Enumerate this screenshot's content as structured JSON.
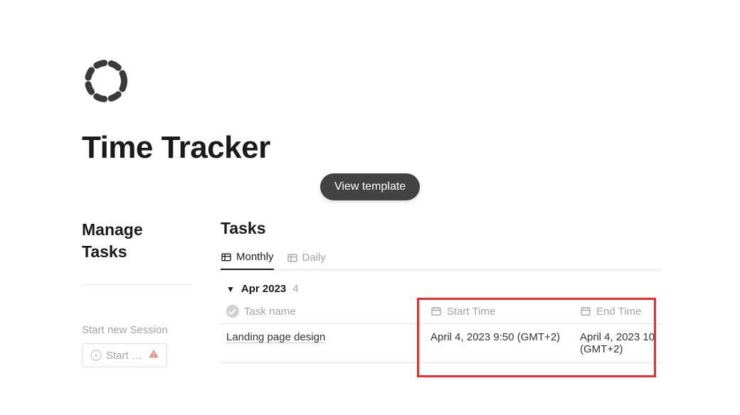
{
  "page": {
    "title": "Time Tracker"
  },
  "view_template_label": "View template",
  "sidebar": {
    "title": "Manage Tasks",
    "session_label": "Start new Session",
    "session_button_label": "Start Ne…"
  },
  "main": {
    "title": "Tasks",
    "tabs": [
      {
        "label": "Monthly",
        "active": true
      },
      {
        "label": "Daily",
        "active": false
      }
    ],
    "group": {
      "label": "Apr 2023",
      "count": "4"
    },
    "columns": {
      "task": "Task name",
      "start": "Start Time",
      "end": "End Time"
    },
    "rows": [
      {
        "task": "Landing page design",
        "start": "April 4, 2023 9:50 (GMT+2)",
        "end": "April 4, 2023 10 (GMT+2)"
      }
    ]
  }
}
